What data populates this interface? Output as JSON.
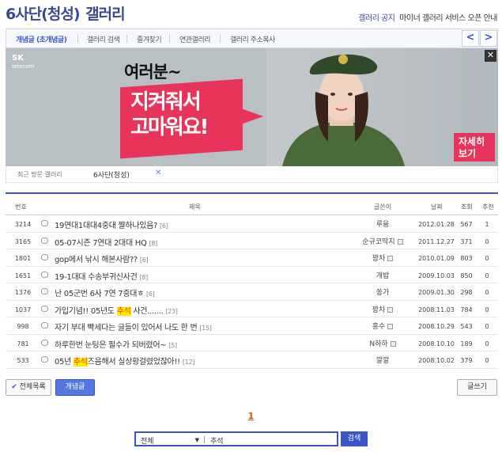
{
  "header": {
    "gallery_name": "6사단(청성)",
    "gallery_word": "갤러리",
    "notice_label": "갤러리 공지",
    "notice_text": "마이너 갤러리 서비스 오픈 안내"
  },
  "tabs": [
    {
      "label": "개념글 (초개념글)",
      "active": true
    },
    {
      "label": "갤러리 검색",
      "active": false
    },
    {
      "label": "즐겨찾기",
      "active": false
    },
    {
      "label": "연관갤러리",
      "active": false
    },
    {
      "label": "갤러리 주소복사",
      "active": false
    }
  ],
  "nav": {
    "prev": "<",
    "next": ">"
  },
  "ad": {
    "brand": "SK",
    "brand_sub": "telecom",
    "headline": "여러분~",
    "bubble_line1": "지켜줘서",
    "bubble_line2": "고마워요!",
    "more_line1": "자세히",
    "more_line2": "보기",
    "close": "✕"
  },
  "recent": {
    "label": "최근 방문 갤러리",
    "item": "6사단(청성)",
    "remove": "✕"
  },
  "table": {
    "columns": [
      "번호",
      "제목",
      "글쓴이",
      "날짜",
      "조회",
      "추천"
    ],
    "rows": [
      {
        "num": "3214",
        "pre": "19연대1대대4중대 짤하나있음?",
        "hl": "",
        "post": "",
        "cmt": "[6]",
        "author": "루을",
        "icon": false,
        "date": "2012.01.28",
        "views": "567",
        "rec": "1"
      },
      {
        "num": "3165",
        "pre": "05-07시즌 7연대 2대대 HQ",
        "hl": "",
        "post": "",
        "cmt": "[8]",
        "author": "순규코딱지",
        "icon": true,
        "date": "2011.12.27",
        "views": "371",
        "rec": "0"
      },
      {
        "num": "1801",
        "pre": "gop에서 낚시 해본사람??",
        "hl": "",
        "post": "",
        "cmt": "[6]",
        "author": "꽝차",
        "icon": true,
        "date": "2010.01.09",
        "views": "803",
        "rec": "0"
      },
      {
        "num": "1651",
        "pre": "19-1대대 수송부귀신사건",
        "hl": "",
        "post": "",
        "cmt": "[8]",
        "author": "개밥",
        "icon": false,
        "date": "2009.10.03",
        "views": "850",
        "rec": "0"
      },
      {
        "num": "1376",
        "pre": "난 05군번 6사 7연 7중대ㅎ",
        "hl": "",
        "post": "",
        "cmt": "[6]",
        "author": "쏭가",
        "icon": false,
        "date": "2009.01.30",
        "views": "298",
        "rec": "0"
      },
      {
        "num": "1037",
        "pre": "가입기념!! 05년도 ",
        "hl": "추석",
        "post": " 사건.......",
        "cmt": "[23]",
        "author": "꽝차",
        "icon": true,
        "date": "2008.11.03",
        "views": "784",
        "rec": "0"
      },
      {
        "num": "998",
        "pre": "자기 부대 빡세다는 글들이 있어서 나도 한 번",
        "hl": "",
        "post": "",
        "cmt": "[15]",
        "author": "홍수",
        "icon": true,
        "date": "2008.10.29",
        "views": "543",
        "rec": "0"
      },
      {
        "num": "781",
        "pre": "하루한번 눈팅은 필수가 되버렸어~",
        "hl": "",
        "post": "",
        "cmt": "[5]",
        "author": "N하하",
        "icon": true,
        "date": "2008.10.10",
        "views": "189",
        "rec": "0"
      },
      {
        "num": "533",
        "pre": "05년 ",
        "hl": "추석",
        "post": "즈음해서 실상황걸렸었잖아!!",
        "cmt": "[12]",
        "author": "깔깔",
        "icon": false,
        "date": "2008.10.02",
        "views": "379",
        "rec": "0"
      }
    ]
  },
  "buttons": {
    "all_list": "전체목록",
    "concept": "개념글",
    "write": "글쓰기",
    "all_list_icon": "✔"
  },
  "pagination": {
    "current": "1"
  },
  "search": {
    "scope": "전체",
    "scope_arrow": "▼",
    "query": "추석",
    "button": "검색"
  },
  "colors": {
    "accent": "#3b55c9",
    "highlight": "#ffea00",
    "ad_pink": "#e8335a"
  }
}
